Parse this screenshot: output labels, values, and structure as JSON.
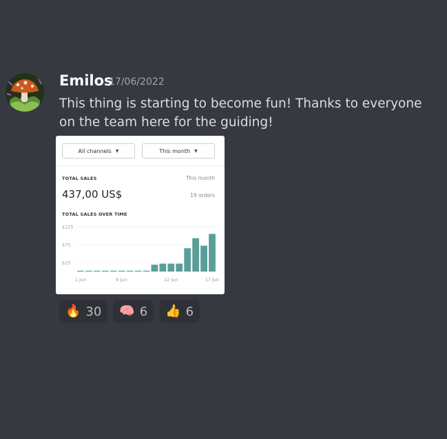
{
  "message": {
    "author": "Emilos",
    "timestamp": "17/06/2022",
    "text": "This thing is starting to become fun! Thanks to everyone on the team here for the guiding!"
  },
  "embed": {
    "channel_filter": "All channels",
    "period_filter": "This month",
    "total_sales_label": "TOTAL SALES",
    "total_sales_period": "This month",
    "total_sales_value": "437,00 US$",
    "orders": "19 orders",
    "chart_title": "TOTAL SALES OVER TIME"
  },
  "chart_data": {
    "type": "bar",
    "title": "TOTAL SALES OVER TIME",
    "yticks": [
      "$125",
      "$75",
      "$25"
    ],
    "ytick_values": [
      125,
      75,
      25
    ],
    "xticks": [
      "1 Jun",
      "6 Jun",
      "12 Jun",
      "17 Jun"
    ],
    "xtick_days": [
      1,
      6,
      12,
      17
    ],
    "days": [
      1,
      2,
      3,
      4,
      5,
      6,
      7,
      8,
      9,
      10,
      11,
      12,
      13,
      14,
      15,
      16,
      17
    ],
    "values": [
      0,
      0,
      0,
      0,
      0,
      0,
      0,
      0,
      0,
      19,
      22,
      22,
      22,
      65,
      93,
      72,
      105
    ],
    "ylim": [
      0,
      125
    ],
    "color": "#5a9e98"
  },
  "reactions": [
    {
      "emoji": "🔥",
      "icon": "fire-icon",
      "count": "30"
    },
    {
      "emoji": "🧠",
      "icon": "brain-icon",
      "count": "6"
    },
    {
      "emoji": "👍",
      "icon": "thumbs-up-icon",
      "count": "6"
    }
  ]
}
